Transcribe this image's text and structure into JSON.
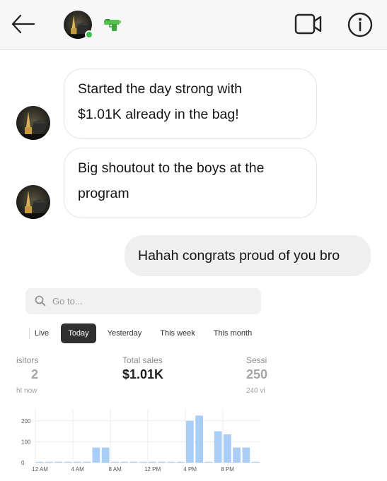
{
  "header": {
    "back_icon": "arrow-left-icon",
    "avatar_icon": "profile-avatar",
    "status": "online",
    "status_color": "#36c24a",
    "emoji_icon": "water-pistol-icon",
    "video_icon": "video-camera-icon",
    "info_icon": "info-circle-icon"
  },
  "messages": [
    {
      "sender": "them",
      "lines": [
        "Started the day strong with",
        "$1.01K already in the bag!"
      ]
    },
    {
      "sender": "them",
      "lines": [
        "Big shoutout to the boys at the",
        "program"
      ]
    },
    {
      "sender": "me",
      "lines": [
        "Hahah congrats proud of you bro"
      ]
    }
  ],
  "embed": {
    "search_placeholder": "Go to...",
    "tabs": [
      "Live",
      "Today",
      "Yesterday",
      "This week",
      "This month"
    ],
    "active_tab": "Today",
    "metrics": [
      {
        "label": "isitors",
        "value": "2",
        "sub": "ht now"
      },
      {
        "label": "Total sales",
        "value": "$1.01K",
        "sub": ""
      },
      {
        "label": "Sessi",
        "value": "250",
        "sub": "240 vi"
      }
    ]
  },
  "chart_data": {
    "type": "bar",
    "ylabel_ticks": [
      "0",
      "100",
      "200"
    ],
    "ylim": [
      0,
      260
    ],
    "x_tick_labels": [
      "12 AM",
      "4 AM",
      "8 AM",
      "12 PM",
      "4 PM",
      "8 PM"
    ],
    "x_tick_hours": [
      0,
      4,
      8,
      12,
      16,
      20
    ],
    "hours": [
      0,
      1,
      2,
      3,
      4,
      5,
      6,
      7,
      8,
      9,
      10,
      11,
      12,
      13,
      14,
      15,
      16,
      17,
      18,
      19,
      20,
      21,
      22,
      23
    ],
    "values": [
      4,
      4,
      4,
      4,
      4,
      4,
      72,
      72,
      4,
      4,
      4,
      4,
      4,
      4,
      4,
      4,
      200,
      225,
      4,
      150,
      135,
      72,
      72,
      4
    ],
    "bar_color": "#a9cdf5",
    "grid": true
  }
}
